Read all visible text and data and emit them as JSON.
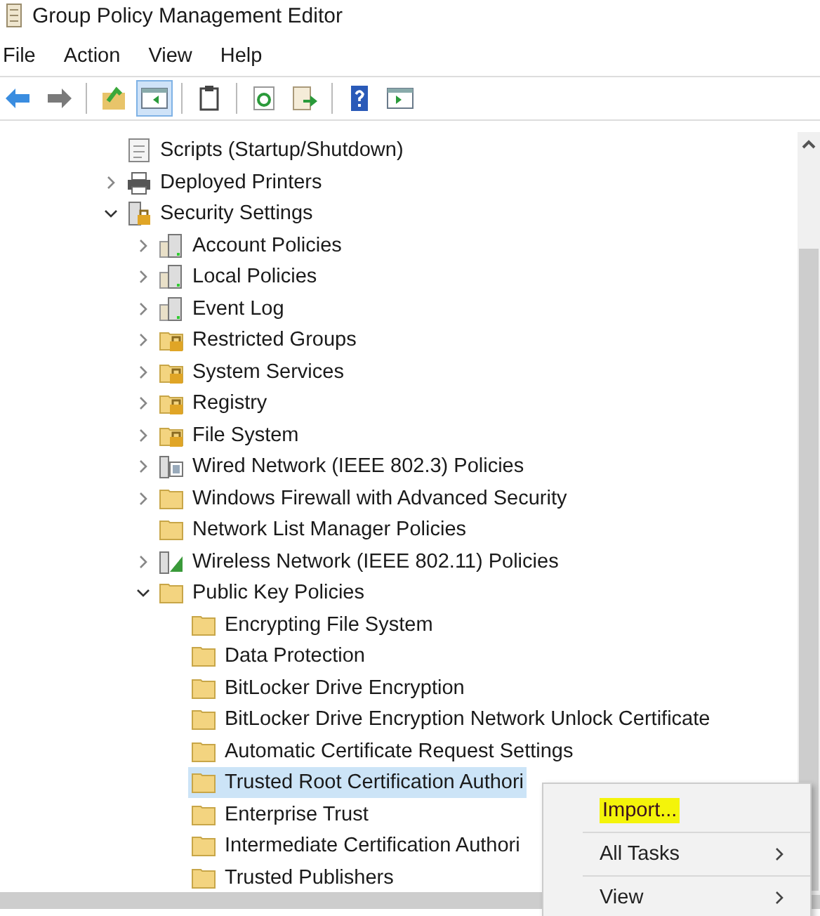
{
  "window": {
    "title": "Group Policy Management Editor"
  },
  "menu": [
    "File",
    "Action",
    "View",
    "Help"
  ],
  "toolbar": [
    [
      {
        "kind": "back",
        "pressed": false
      },
      {
        "kind": "forward",
        "pressed": false
      }
    ],
    [
      {
        "kind": "up",
        "pressed": false
      },
      {
        "kind": "tree",
        "pressed": true
      }
    ],
    [
      {
        "kind": "properties",
        "pressed": false
      }
    ],
    [
      {
        "kind": "refresh",
        "pressed": false
      },
      {
        "kind": "export",
        "pressed": false
      }
    ],
    [
      {
        "kind": "help",
        "pressed": false
      },
      {
        "kind": "pane",
        "pressed": false
      }
    ]
  ],
  "tree": [
    {
      "label": "Scripts (Startup/Shutdown)",
      "kind": "script",
      "selected": false
    },
    {
      "label": "Deployed Printers",
      "kind": "printer",
      "expanded": false,
      "selected": false
    },
    {
      "label": "Security Settings",
      "kind": "security",
      "expanded": true,
      "selected": false,
      "children": [
        {
          "label": "Account Policies",
          "kind": "server",
          "expanded": false,
          "selected": false
        },
        {
          "label": "Local Policies",
          "kind": "server",
          "expanded": false,
          "selected": false
        },
        {
          "label": "Event Log",
          "kind": "server",
          "expanded": false,
          "selected": false
        },
        {
          "label": "Restricted Groups",
          "kind": "lockfolder",
          "expanded": false,
          "selected": false
        },
        {
          "label": "System Services",
          "kind": "lockfolder",
          "expanded": false,
          "selected": false
        },
        {
          "label": "Registry",
          "kind": "lockfolder",
          "expanded": false,
          "selected": false
        },
        {
          "label": "File System",
          "kind": "lockfolder",
          "expanded": false,
          "selected": false
        },
        {
          "label": "Wired Network (IEEE 802.3) Policies",
          "kind": "network",
          "expanded": false,
          "selected": false
        },
        {
          "label": "Windows Firewall with Advanced Security",
          "kind": "folder",
          "expanded": false,
          "selected": false
        },
        {
          "label": "Network List Manager Policies",
          "kind": "folder",
          "selected": false
        },
        {
          "label": "Wireless Network (IEEE 802.11) Policies",
          "kind": "wireless",
          "expanded": false,
          "selected": false
        },
        {
          "label": "Public Key Policies",
          "kind": "folder",
          "expanded": true,
          "selected": false,
          "children": [
            {
              "label": "Encrypting File System",
              "kind": "folder",
              "selected": false
            },
            {
              "label": "Data Protection",
              "kind": "folder",
              "selected": false
            },
            {
              "label": "BitLocker Drive Encryption",
              "kind": "folder",
              "selected": false
            },
            {
              "label": "BitLocker Drive Encryption Network Unlock Certificate",
              "kind": "folder",
              "selected": false
            },
            {
              "label": "Automatic Certificate Request Settings",
              "kind": "folder",
              "selected": false
            },
            {
              "label": "Trusted Root Certification Authori",
              "kind": "folder",
              "selected": true
            },
            {
              "label": "Enterprise Trust",
              "kind": "folder",
              "selected": false
            },
            {
              "label": "Intermediate Certification Authori",
              "kind": "folder",
              "selected": false
            },
            {
              "label": "Trusted Publishers",
              "kind": "folder",
              "selected": false
            }
          ]
        }
      ]
    }
  ],
  "context_menu": [
    {
      "label": "Import...",
      "submenu": false,
      "highlighted": true
    },
    {
      "label": "All Tasks",
      "submenu": true,
      "highlighted": false
    },
    {
      "label": "View",
      "submenu": true,
      "highlighted": false
    }
  ]
}
